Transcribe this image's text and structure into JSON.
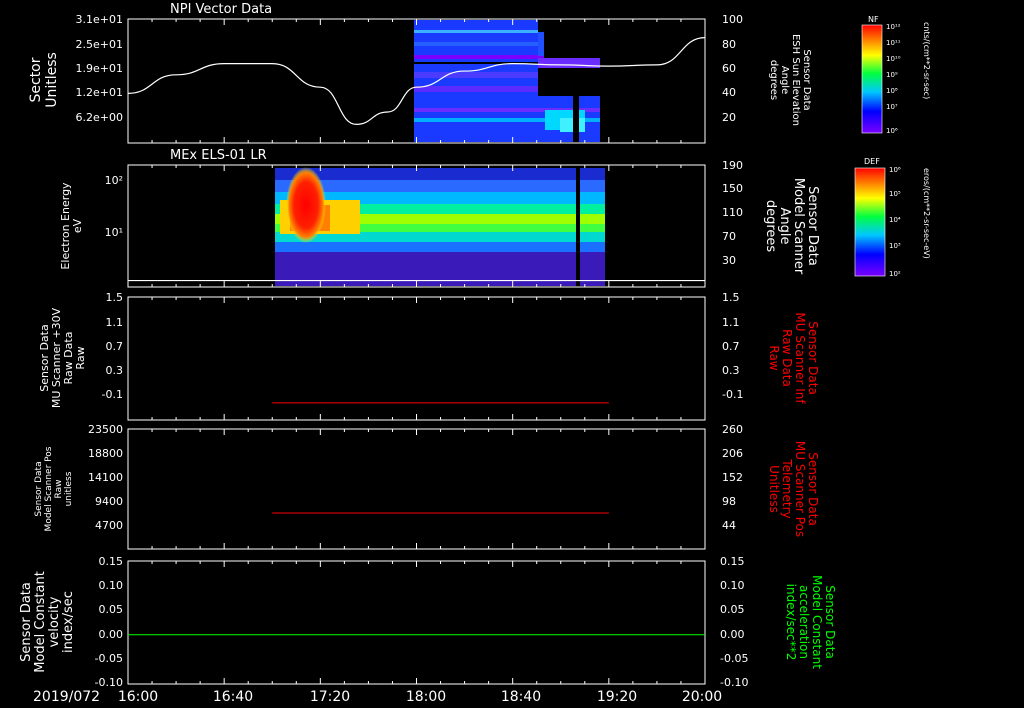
{
  "date_label": "2019/072",
  "time_ticks": [
    "16:00",
    "16:40",
    "17:20",
    "18:00",
    "18:40",
    "19:20",
    "20:00"
  ],
  "colors": {
    "red": "#ff0000",
    "green": "#00ff00",
    "white": "#ffffff",
    "black": "#000000"
  },
  "panels": [
    {
      "title": "NPI Vector Data",
      "left_label": [
        "Sector",
        "Unitless"
      ],
      "left_ticks": [
        "3.1e+01",
        "2.5e+01",
        "1.9e+01",
        "1.2e+01",
        "6.2e+00"
      ],
      "right_label": [
        "Sensor Data",
        "ESH Sun Elevation",
        "Angle",
        "degrees"
      ],
      "right_ticks": [
        "100",
        "80",
        "60",
        "40",
        "20"
      ],
      "colorbar": {
        "title": "NF",
        "top": "10¹²",
        "ticks": [
          "10¹¹",
          "10¹⁰",
          "10⁹",
          "10⁸",
          "10⁷"
        ],
        "bottom": "10⁶",
        "units": "cnts/(cm**2-sr-sec)"
      }
    },
    {
      "title": "MEx ELS-01 LR",
      "left_label": [
        "Electron Energy",
        "eV"
      ],
      "left_ticks": [
        "10²",
        "10¹"
      ],
      "right_label": [
        "Sensor Data",
        "Model Scanner",
        "Angle",
        "degrees"
      ],
      "right_ticks": [
        "190",
        "150",
        "110",
        "70",
        "30"
      ],
      "colorbar": {
        "title": "DEF",
        "top": "10⁶",
        "ticks": [
          "10⁵",
          "10⁴",
          "10³"
        ],
        "bottom": "10²",
        "units": "eros/(cm**2-sr-sec-eV)"
      }
    },
    {
      "left_label": [
        "Sensor Data",
        "MU Scanner +30V",
        "Raw Data",
        "Raw"
      ],
      "left_ticks": [
        "1.5",
        "1.1",
        "0.7",
        "0.3",
        "-0.1"
      ],
      "right_label": [
        "Sensor Data",
        "MU Scanner Inf",
        "Raw Data",
        "Raw"
      ],
      "right_ticks": [
        "1.5",
        "1.1",
        "0.7",
        "0.3",
        "-0.1"
      ]
    },
    {
      "left_label": [
        "Sensor Data",
        "Model Scanner Pos",
        "Raw",
        "unitless"
      ],
      "left_ticks": [
        "23500",
        "18800",
        "14100",
        "9400",
        "4700"
      ],
      "right_label": [
        "Sensor Data",
        "MU Scanner Pos",
        "Telemetry",
        "Unitless"
      ],
      "right_ticks": [
        "260",
        "206",
        "152",
        "98",
        "44"
      ]
    },
    {
      "left_label": [
        "Sensor Data",
        "Model Constant",
        "velocity",
        "index/sec"
      ],
      "left_ticks": [
        "0.15",
        "0.10",
        "0.05",
        "0.00",
        "-0.05",
        "-0.10"
      ],
      "right_label": [
        "Sensor Data",
        "Model Constant",
        "acceleration",
        "index/sec**2"
      ],
      "right_ticks": [
        "0.15",
        "0.10",
        "0.05",
        "0.00",
        "-0.05",
        "-0.10"
      ]
    }
  ],
  "chart_data": [
    {
      "type": "heatmap",
      "title": "NPI Vector Data",
      "x_range": [
        "16:00",
        "20:00"
      ],
      "ylabel": "Sector Unitless",
      "ylim": [
        0,
        31
      ],
      "data_span": [
        "17:48",
        "19:10"
      ],
      "overlay_line": {
        "ylabel": "Sensor Data ESH Sun Elevation Angle degrees",
        "ylim": [
          0,
          100
        ],
        "color": "#ffffff",
        "x": [
          "16:00",
          "16:20",
          "16:40",
          "17:00",
          "17:20",
          "17:35",
          "17:48",
          "18:00",
          "18:20",
          "18:40",
          "19:00",
          "19:20",
          "19:40",
          "20:00"
        ],
        "y": [
          40,
          55,
          64,
          64,
          45,
          15,
          25,
          45,
          58,
          64,
          63,
          62,
          63,
          85
        ]
      }
    },
    {
      "type": "heatmap",
      "title": "MEx ELS-01 LR",
      "x_range": [
        "16:00",
        "20:00"
      ],
      "ylabel": "Electron Energy eV",
      "yscale": "log",
      "data_span": [
        "17:05",
        "19:15"
      ],
      "peak_time": "17:16",
      "overlay_line": {
        "ylabel": "Sensor Data Model Scanner Angle degrees",
        "ylim": [
          0,
          190
        ],
        "color": "#ffffff",
        "x": [
          "16:00",
          "20:00"
        ],
        "y": [
          10,
          10
        ]
      }
    },
    {
      "type": "line",
      "ylabel": "Sensor Data MU Scanner +30V Raw Data Raw",
      "ylim": [
        -0.3,
        1.5
      ],
      "series": [
        {
          "color": "#ff0000",
          "x": [
            "17:00",
            "19:20"
          ],
          "y": [
            -0.05,
            -0.05
          ]
        }
      ]
    },
    {
      "type": "line",
      "ylabel": "Sensor Data Model Scanner Pos Raw unitless",
      "ylim": [
        0,
        23500
      ],
      "series": [
        {
          "color": "#ff0000",
          "x": [
            "17:00",
            "19:20"
          ],
          "y": [
            7050,
            7050
          ]
        }
      ]
    },
    {
      "type": "line",
      "ylabel": "Sensor Data Model Constant velocity index/sec",
      "ylim": [
        -0.1,
        0.15
      ],
      "series": [
        {
          "color": "#00ff00",
          "x": [
            "16:00",
            "20:00"
          ],
          "y": [
            0.0,
            0.0
          ]
        }
      ]
    }
  ]
}
